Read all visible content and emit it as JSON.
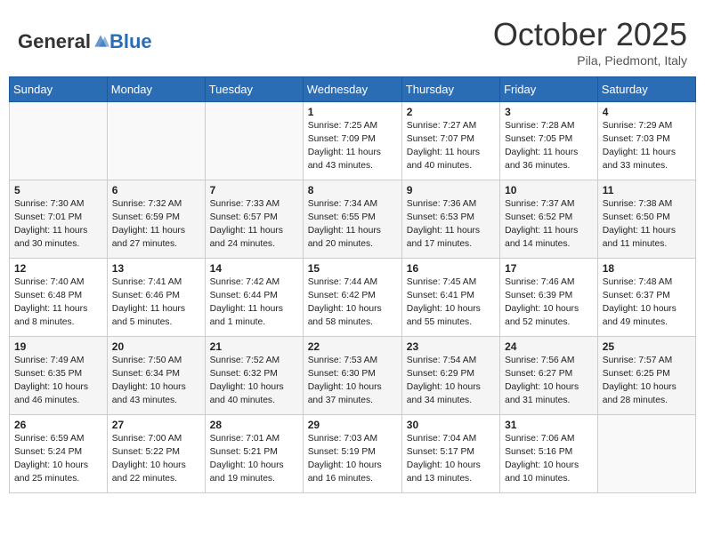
{
  "header": {
    "logo_general": "General",
    "logo_blue": "Blue",
    "month": "October 2025",
    "location": "Pila, Piedmont, Italy"
  },
  "days_of_week": [
    "Sunday",
    "Monday",
    "Tuesday",
    "Wednesday",
    "Thursday",
    "Friday",
    "Saturday"
  ],
  "weeks": [
    [
      {
        "day": "",
        "info": ""
      },
      {
        "day": "",
        "info": ""
      },
      {
        "day": "",
        "info": ""
      },
      {
        "day": "1",
        "info": "Sunrise: 7:25 AM\nSunset: 7:09 PM\nDaylight: 11 hours and 43 minutes."
      },
      {
        "day": "2",
        "info": "Sunrise: 7:27 AM\nSunset: 7:07 PM\nDaylight: 11 hours and 40 minutes."
      },
      {
        "day": "3",
        "info": "Sunrise: 7:28 AM\nSunset: 7:05 PM\nDaylight: 11 hours and 36 minutes."
      },
      {
        "day": "4",
        "info": "Sunrise: 7:29 AM\nSunset: 7:03 PM\nDaylight: 11 hours and 33 minutes."
      }
    ],
    [
      {
        "day": "5",
        "info": "Sunrise: 7:30 AM\nSunset: 7:01 PM\nDaylight: 11 hours and 30 minutes."
      },
      {
        "day": "6",
        "info": "Sunrise: 7:32 AM\nSunset: 6:59 PM\nDaylight: 11 hours and 27 minutes."
      },
      {
        "day": "7",
        "info": "Sunrise: 7:33 AM\nSunset: 6:57 PM\nDaylight: 11 hours and 24 minutes."
      },
      {
        "day": "8",
        "info": "Sunrise: 7:34 AM\nSunset: 6:55 PM\nDaylight: 11 hours and 20 minutes."
      },
      {
        "day": "9",
        "info": "Sunrise: 7:36 AM\nSunset: 6:53 PM\nDaylight: 11 hours and 17 minutes."
      },
      {
        "day": "10",
        "info": "Sunrise: 7:37 AM\nSunset: 6:52 PM\nDaylight: 11 hours and 14 minutes."
      },
      {
        "day": "11",
        "info": "Sunrise: 7:38 AM\nSunset: 6:50 PM\nDaylight: 11 hours and 11 minutes."
      }
    ],
    [
      {
        "day": "12",
        "info": "Sunrise: 7:40 AM\nSunset: 6:48 PM\nDaylight: 11 hours and 8 minutes."
      },
      {
        "day": "13",
        "info": "Sunrise: 7:41 AM\nSunset: 6:46 PM\nDaylight: 11 hours and 5 minutes."
      },
      {
        "day": "14",
        "info": "Sunrise: 7:42 AM\nSunset: 6:44 PM\nDaylight: 11 hours and 1 minute."
      },
      {
        "day": "15",
        "info": "Sunrise: 7:44 AM\nSunset: 6:42 PM\nDaylight: 10 hours and 58 minutes."
      },
      {
        "day": "16",
        "info": "Sunrise: 7:45 AM\nSunset: 6:41 PM\nDaylight: 10 hours and 55 minutes."
      },
      {
        "day": "17",
        "info": "Sunrise: 7:46 AM\nSunset: 6:39 PM\nDaylight: 10 hours and 52 minutes."
      },
      {
        "day": "18",
        "info": "Sunrise: 7:48 AM\nSunset: 6:37 PM\nDaylight: 10 hours and 49 minutes."
      }
    ],
    [
      {
        "day": "19",
        "info": "Sunrise: 7:49 AM\nSunset: 6:35 PM\nDaylight: 10 hours and 46 minutes."
      },
      {
        "day": "20",
        "info": "Sunrise: 7:50 AM\nSunset: 6:34 PM\nDaylight: 10 hours and 43 minutes."
      },
      {
        "day": "21",
        "info": "Sunrise: 7:52 AM\nSunset: 6:32 PM\nDaylight: 10 hours and 40 minutes."
      },
      {
        "day": "22",
        "info": "Sunrise: 7:53 AM\nSunset: 6:30 PM\nDaylight: 10 hours and 37 minutes."
      },
      {
        "day": "23",
        "info": "Sunrise: 7:54 AM\nSunset: 6:29 PM\nDaylight: 10 hours and 34 minutes."
      },
      {
        "day": "24",
        "info": "Sunrise: 7:56 AM\nSunset: 6:27 PM\nDaylight: 10 hours and 31 minutes."
      },
      {
        "day": "25",
        "info": "Sunrise: 7:57 AM\nSunset: 6:25 PM\nDaylight: 10 hours and 28 minutes."
      }
    ],
    [
      {
        "day": "26",
        "info": "Sunrise: 6:59 AM\nSunset: 5:24 PM\nDaylight: 10 hours and 25 minutes."
      },
      {
        "day": "27",
        "info": "Sunrise: 7:00 AM\nSunset: 5:22 PM\nDaylight: 10 hours and 22 minutes."
      },
      {
        "day": "28",
        "info": "Sunrise: 7:01 AM\nSunset: 5:21 PM\nDaylight: 10 hours and 19 minutes."
      },
      {
        "day": "29",
        "info": "Sunrise: 7:03 AM\nSunset: 5:19 PM\nDaylight: 10 hours and 16 minutes."
      },
      {
        "day": "30",
        "info": "Sunrise: 7:04 AM\nSunset: 5:17 PM\nDaylight: 10 hours and 13 minutes."
      },
      {
        "day": "31",
        "info": "Sunrise: 7:06 AM\nSunset: 5:16 PM\nDaylight: 10 hours and 10 minutes."
      },
      {
        "day": "",
        "info": ""
      }
    ]
  ]
}
